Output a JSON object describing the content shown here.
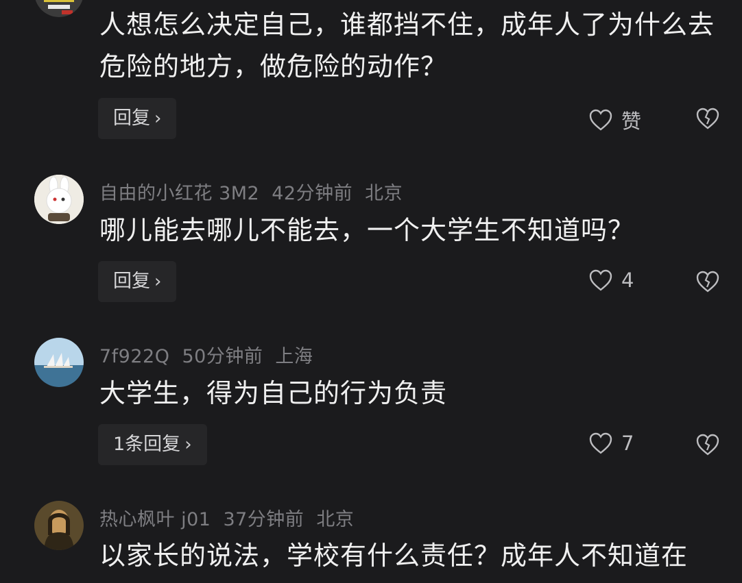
{
  "comments": [
    {
      "username": "",
      "time": "",
      "location": "",
      "text": "人想怎么决定自己，谁都挡不住，成年人了为什么去危险的地方，做危险的动作？",
      "reply_label": "回复",
      "like_count": "赞",
      "avatar_icon": "poster-avatar-icon"
    },
    {
      "username": "自由的小红花 3M2",
      "time": "42分钟前",
      "location": "北京",
      "text": "哪儿能去哪儿不能去，一个大学生不知道吗？",
      "reply_label": "回复",
      "like_count": "4",
      "avatar_icon": "rabbit-avatar-icon"
    },
    {
      "username": "7f922Q",
      "time": "50分钟前",
      "location": "上海",
      "text": "大学生，得为自己的行为负责",
      "reply_label": "1条回复",
      "like_count": "7",
      "avatar_icon": "opera-house-avatar-icon"
    },
    {
      "username": "热心枫叶 j01",
      "time": "37分钟前",
      "location": "北京",
      "text": "以家长的说法，学校有什么责任？成年人不知道在",
      "reply_label": "",
      "like_count": "",
      "avatar_icon": "portrait-avatar-icon"
    }
  ],
  "colors": {
    "background": "#1b1b1d",
    "meta_text": "#7e7e82",
    "reply_button_bg": "#262628"
  }
}
